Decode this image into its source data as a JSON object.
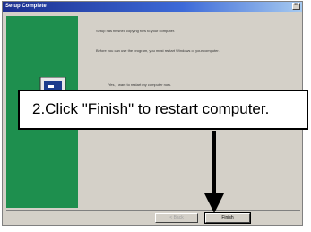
{
  "window": {
    "title": "Setup Complete",
    "close_glyph": "×"
  },
  "content": {
    "lines": [
      "Setup has finished copying files to your computer.",
      "Before you can use the program, you must restart Windows or your computer.",
      "Yes, I want to restart my computer now."
    ]
  },
  "buttons": {
    "back": "< Back",
    "finish": "Finish"
  },
  "callout": {
    "text": "2.Click \"Finish\" to restart computer."
  },
  "colors": {
    "panel": "#1e8f4e",
    "titlebar": "#1b2f8f",
    "dialog": "#d4d0c8"
  }
}
